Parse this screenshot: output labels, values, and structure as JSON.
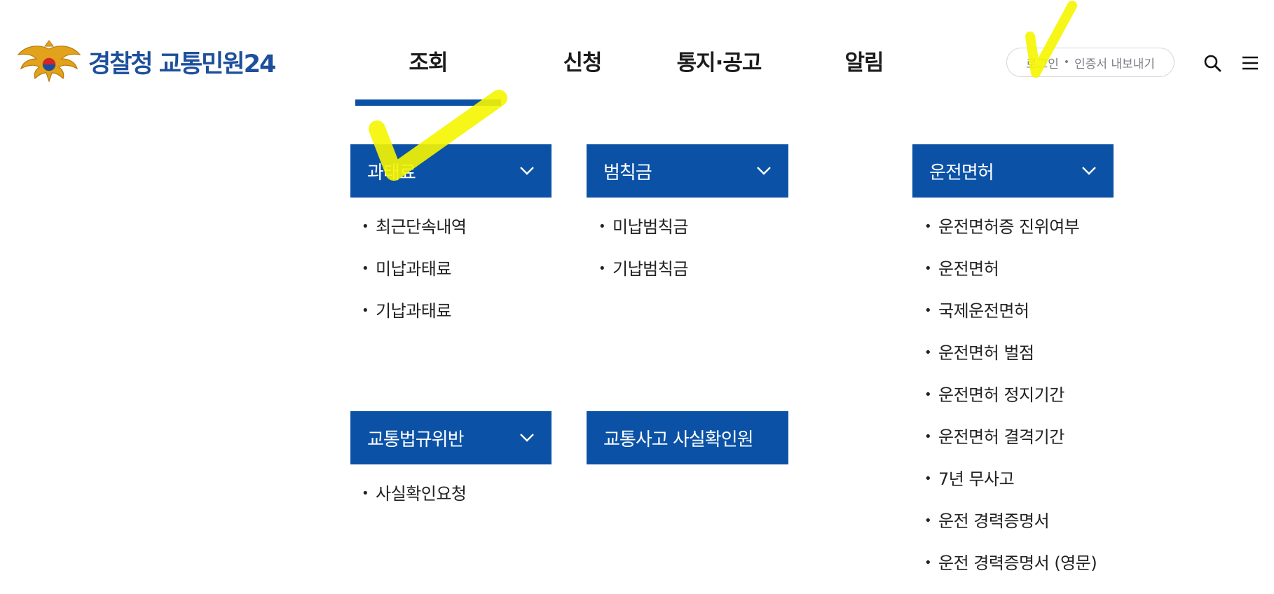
{
  "header": {
    "logo_text": "경찰청 교통민원24",
    "nav": [
      {
        "label": "조회",
        "active": true
      },
      {
        "label": "신청",
        "active": false
      },
      {
        "label": "통지·공고",
        "active": false
      },
      {
        "label": "알림",
        "active": false
      }
    ],
    "login_label": "로그인",
    "cert_label": "인증서 내보내기",
    "search_icon": "search-icon",
    "menu_icon": "hamburger-menu-icon"
  },
  "dropdown": {
    "categories": [
      {
        "title": "과태료",
        "expandable": true,
        "items": [
          "최근단속내역",
          "미납과태료",
          "기납과태료"
        ]
      },
      {
        "title": "범칙금",
        "expandable": true,
        "items": [
          "미납범칙금",
          "기납범칙금"
        ]
      },
      {
        "title": "운전면허",
        "expandable": true,
        "items": [
          "운전면허증 진위여부",
          "운전면허",
          "국제운전면허",
          "운전면허 벌점",
          "운전면허 정지기간",
          "운전면허 결격기간",
          "7년 무사고",
          "운전 경력증명서",
          "운전 경력증명서 (영문)"
        ]
      },
      {
        "title": "교통법규위반",
        "expandable": true,
        "items": [
          "사실확인요청"
        ]
      },
      {
        "title": "교통사고 사실확인원",
        "expandable": false,
        "items": []
      }
    ]
  },
  "colors": {
    "primary": "#0b52a6",
    "logo_text": "#1d4f9c",
    "highlight": "#f5f500"
  }
}
